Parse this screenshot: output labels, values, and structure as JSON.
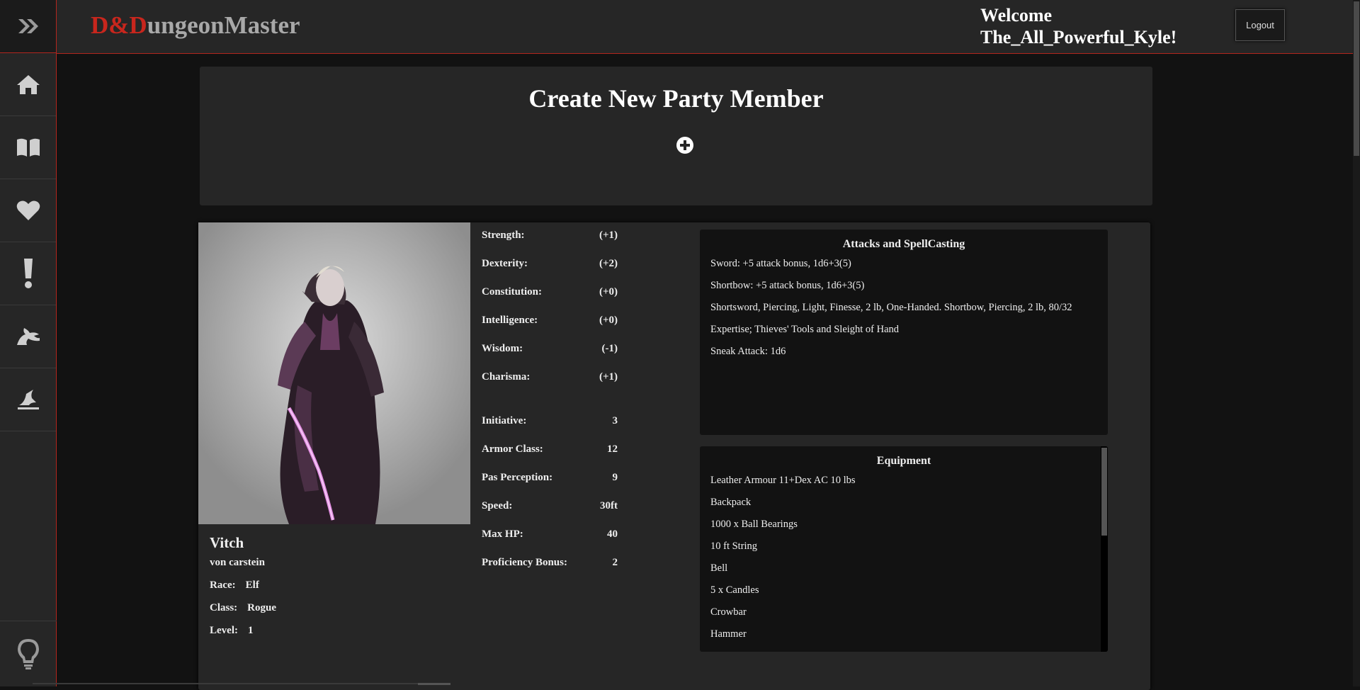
{
  "sidebar": {
    "toggle_icon": "double-chevron-right-icon",
    "items": [
      {
        "icon": "home-icon"
      },
      {
        "icon": "book-icon"
      },
      {
        "icon": "heart-icon"
      },
      {
        "icon": "exclamation-icon"
      },
      {
        "icon": "monster-icon"
      },
      {
        "icon": "wizard-hat-icon"
      }
    ],
    "bottom_icon": "lightbulb-icon"
  },
  "header": {
    "logo_prefix": "D&D",
    "logo_suffix": "ungeonMaster",
    "welcome_line1": "Welcome",
    "welcome_line2": "The_All_Powerful_Kyle!",
    "logout_label": "Logout"
  },
  "create": {
    "title": "Create New Party Member",
    "add_icon": "plus-circle-icon"
  },
  "character": {
    "name": "Vitch",
    "surname": "von carstein",
    "race_label": "Race:",
    "race": "Elf",
    "class_label": "Class:",
    "class": "Rogue",
    "level_label": "Level:",
    "level": "1",
    "abilities": [
      {
        "label": "Strength:",
        "value": "(+1)"
      },
      {
        "label": "Dexterity:",
        "value": "(+2)"
      },
      {
        "label": "Constitution:",
        "value": "(+0)"
      },
      {
        "label": "Intelligence:",
        "value": "(+0)"
      },
      {
        "label": "Wisdom:",
        "value": "(-1)"
      },
      {
        "label": "Charisma:",
        "value": "(+1)"
      }
    ],
    "combat": [
      {
        "label": "Initiative:",
        "value": "3"
      },
      {
        "label": "Armor Class:",
        "value": "12"
      },
      {
        "label": "Pas Perception:",
        "value": "9"
      },
      {
        "label": "Speed:",
        "value": "30ft"
      },
      {
        "label": "Max HP:",
        "value": "40"
      },
      {
        "label": "Proficiency Bonus:",
        "value": "2"
      }
    ],
    "attacks": {
      "title": "Attacks and SpellCasting",
      "lines": [
        "Sword: +5 attack bonus, 1d6+3(5)",
        "Shortbow: +5 attack bonus, 1d6+3(5)",
        "Shortsword, Piercing, Light, Finesse, 2 lb, One-Handed. Shortbow, Piercing, 2 lb, 80/32",
        "Expertise; Thieves' Tools and Sleight of Hand",
        "Sneak Attack: 1d6"
      ]
    },
    "equipment": {
      "title": "Equipment",
      "items": [
        "Leather Armour 11+Dex AC 10 lbs",
        "Backpack",
        "1000 x Ball Bearings",
        "10 ft String",
        "Bell",
        "5 x Candles",
        "Crowbar",
        "Hammer"
      ]
    }
  }
}
